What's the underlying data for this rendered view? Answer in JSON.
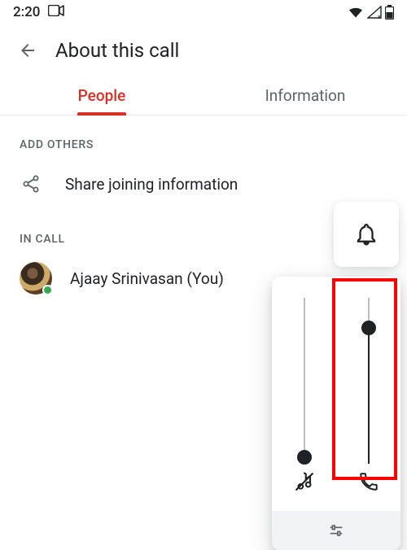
{
  "status": {
    "time": "2:20"
  },
  "header": {
    "title": "About this call"
  },
  "tabs": {
    "people": "People",
    "information": "Information",
    "active": "people"
  },
  "sections": {
    "addOthersLabel": "ADD OTHERS",
    "shareLabel": "Share joining information",
    "inCallLabel": "IN CALL"
  },
  "participants": [
    {
      "name": "Ajaay Srinivasan (You)",
      "presence": "online"
    }
  ],
  "volume": {
    "media": {
      "value": 4,
      "max": 100
    },
    "call": {
      "value": 82,
      "max": 100
    }
  }
}
